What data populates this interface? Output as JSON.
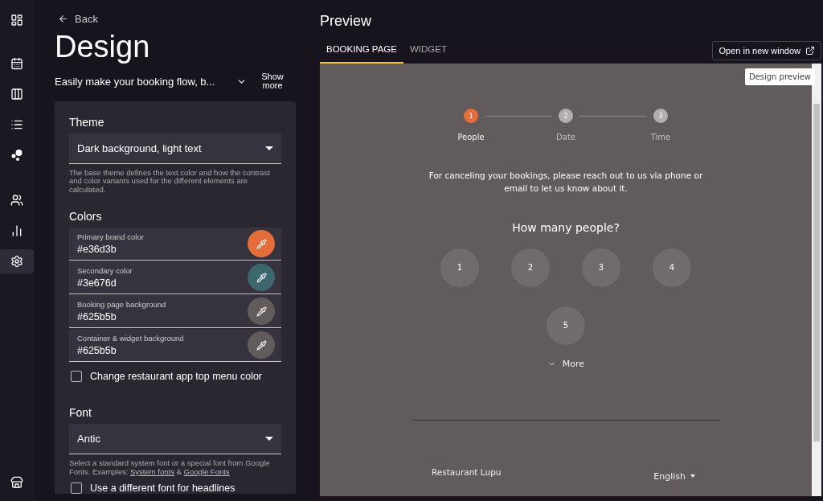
{
  "nav": [
    {
      "kind": "dashboard",
      "selected": false
    },
    {
      "kind": "calendar",
      "selected": false
    },
    {
      "kind": "columns",
      "selected": false
    },
    {
      "kind": "list",
      "selected": false
    },
    {
      "kind": "bubbles",
      "selected": false
    },
    {
      "kind": "people",
      "selected": false
    },
    {
      "kind": "chart",
      "selected": false
    },
    {
      "kind": "settings",
      "selected": true
    }
  ],
  "nav_bottom": {
    "kind": "store"
  },
  "back": "Back",
  "title": "Design",
  "description": "Easily make your booking flow, b...",
  "show_more": "Show more",
  "theme": {
    "heading": "Theme",
    "value": "Dark background, light text",
    "help": "The base theme defines the text color and how the contrast and color variants used for the different elements are calculated."
  },
  "colors": {
    "heading": "Colors",
    "items": [
      {
        "label": "Primary brand color",
        "value": "#e36d3b",
        "color": "#e36d3b"
      },
      {
        "label": "Secondary color",
        "value": "#3e676d",
        "color": "#3e676d"
      },
      {
        "label": "Booking page background",
        "value": "#625b5b",
        "color": "#625b5b"
      },
      {
        "label": "Container & widget background",
        "value": "#625b5b",
        "color": "#625b5b"
      }
    ]
  },
  "menu_color_checkbox": {
    "label": "Change restaurant app top menu color",
    "checked": false
  },
  "font": {
    "heading": "Font",
    "value": "Antic",
    "help": "Select a standard system font or a special font from Google Fonts. Examples: ",
    "links": [
      "System fonts",
      "Google Fonts"
    ],
    "joiner": " & "
  },
  "headline_font_checkbox": {
    "label": "Use a different font for headlines",
    "checked": false
  },
  "preview": {
    "title": "Preview",
    "tabs": [
      {
        "label": "BOOKING PAGE",
        "selected": true
      },
      {
        "label": "WIDGET",
        "selected": false
      }
    ],
    "open_button": "Open in new window",
    "tooltip": "Design preview",
    "steps": [
      {
        "number": "1",
        "label": "People",
        "selected": true
      },
      {
        "number": "2",
        "label": "Date",
        "selected": false
      },
      {
        "number": "3",
        "label": "Time",
        "selected": false
      }
    ],
    "notice": "For canceling your bookings, please reach out to us via phone or email to let us know about it.",
    "question": "How many people?",
    "options": [
      "1",
      "2",
      "3",
      "4",
      "5"
    ],
    "more": "More",
    "restaurant": "Restaurant Lupu",
    "language": "English"
  }
}
